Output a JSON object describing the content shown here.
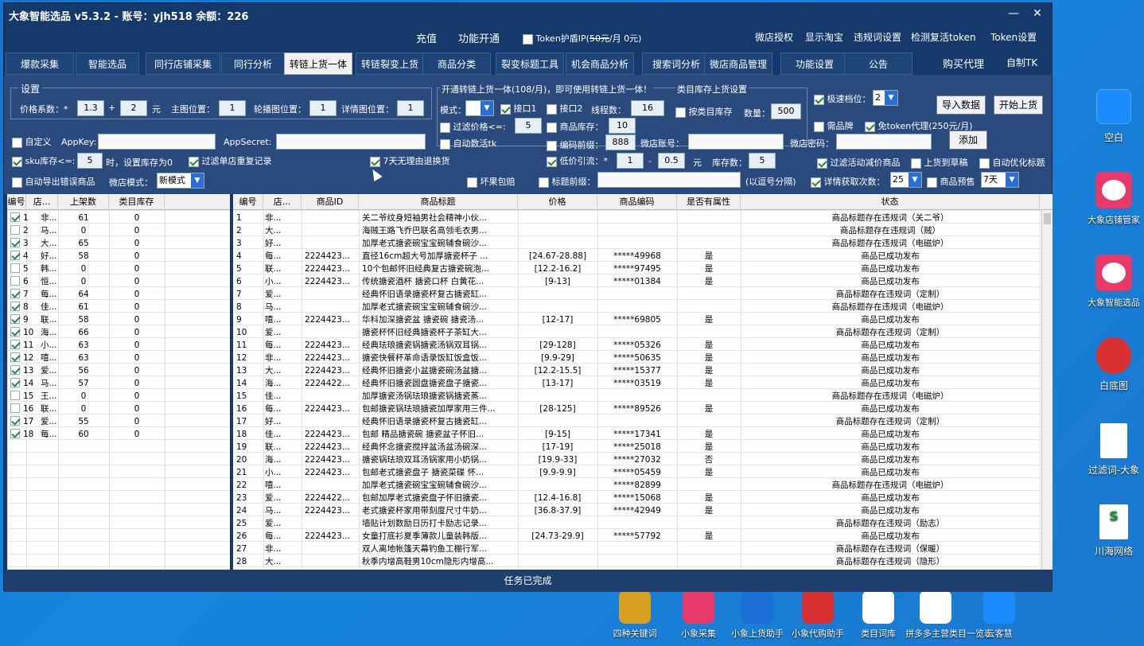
{
  "window": {
    "title": "大象智能选品 v5.3.2 - 账号：yjh518 余额：226",
    "minimize": "—",
    "close": "✕"
  },
  "topmenu": {
    "recharge": "充值",
    "func_open": "功能开通",
    "token_label": "Token护盾IP(",
    "token_price_strike": "50元",
    "token_price_rest": "/月  0元)",
    "store_auth": "微店授权",
    "show_taobao": "显示淘宝",
    "violation_set": "违规词设置",
    "detect_token": "检测复活token",
    "token_set": "Token设置"
  },
  "tabs": [
    "爆款采集",
    "智能选品",
    "同行店铺采集",
    "同行分析",
    "转链上货一体",
    "转链裂变上货",
    "商品分类",
    "裂变标题工具",
    "机会商品分析",
    "搜索词分析",
    "微店商品管理",
    "功能设置",
    "公告"
  ],
  "active_tab": 4,
  "tab_right": {
    "buy_agent": "购买代理",
    "custom_tk": "自制TK"
  },
  "settings": {
    "legend": "设置",
    "price_coef": "价格系数：*",
    "price_coef_val": "1.3",
    "plus": "+",
    "add_val": "2",
    "yuan": "元",
    "main_img": "主图位置：",
    "main_img_val": "1",
    "carousel": "轮播图位置：",
    "carousel_val": "1",
    "detail": "详情图位置：",
    "detail_val": "1",
    "custom": "自定义",
    "appkey": "AppKey:",
    "appsecret": "AppSecret:",
    "sku": "sku库存<=:",
    "sku_val": "5",
    "sku_suffix": "时，设置库存为0",
    "filter_dup": "过滤单店重复记录",
    "seven_day": "7天无理由退换货",
    "auto_export": "自动导出错误商品",
    "store_mode": "微店模式：",
    "store_mode_val": "新模式",
    "bad_fruit": "坏果包赔",
    "title_prefix": "标题前缀：",
    "comma_split": "(以逗号分隔)"
  },
  "open": {
    "legend": "开通转链上货一体(108/月)，即可使用转链上货一体！",
    "mode": "模式：",
    "iface1": "接口1",
    "iface2": "接口2",
    "threads": "线程数：",
    "threads_val": "16",
    "filter_price": "过滤价格<=:",
    "filter_price_val": "5",
    "stock": "商品库存：",
    "stock_val": "10",
    "auto_tk": "自动数活tk",
    "code_prefix": "编码前缀：",
    "code_prefix_val": "888",
    "store_acc": "微店账号：",
    "store_pwd": "微店密码：",
    "add_btn": "添加",
    "low_price": "低价引流：*",
    "low_a": "1",
    "dash": "-",
    "low_b": "0.5",
    "yuan": "元",
    "stock_num": "库存数：",
    "stock_num_val": "5"
  },
  "cat": {
    "legend": "类目库存上货设置",
    "by_cat": "按类目库存",
    "qty": "数量：",
    "qty_val": "500"
  },
  "right": {
    "speed": "极速档位：",
    "speed_val": "2",
    "need_brand": "需品牌",
    "free_token": "免token代理(250元/月)",
    "import": "导入数据",
    "start": "开始上货",
    "filter_promo": "过滤活动减价商品",
    "to_draft": "上货到草稿",
    "auto_opt": "自动优化标题",
    "detail_times": "详情获取次数：",
    "detail_times_val": "25",
    "presale": "商品预售",
    "presale_val": "7天"
  },
  "left_grid": {
    "headers": [
      "编号",
      "店...",
      "上架数",
      "类目库存"
    ],
    "rows": [
      {
        "id": "1",
        "shop": "非...",
        "count": "61",
        "cat": "0",
        "on": true
      },
      {
        "id": "2",
        "shop": "马...",
        "count": "0",
        "cat": "0",
        "on": false
      },
      {
        "id": "3",
        "shop": "大...",
        "count": "65",
        "cat": "0",
        "on": true
      },
      {
        "id": "4",
        "shop": "好...",
        "count": "58",
        "cat": "0",
        "on": true
      },
      {
        "id": "5",
        "shop": "韩...",
        "count": "0",
        "cat": "0",
        "on": false
      },
      {
        "id": "6",
        "shop": "恒...",
        "count": "0",
        "cat": "0",
        "on": false
      },
      {
        "id": "7",
        "shop": "每...",
        "count": "64",
        "cat": "0",
        "on": true
      },
      {
        "id": "8",
        "shop": "佳...",
        "count": "61",
        "cat": "0",
        "on": true
      },
      {
        "id": "9",
        "shop": "联...",
        "count": "58",
        "cat": "0",
        "on": true
      },
      {
        "id": "10",
        "shop": "海...",
        "count": "66",
        "cat": "0",
        "on": true
      },
      {
        "id": "11",
        "shop": "小...",
        "count": "63",
        "cat": "0",
        "on": true
      },
      {
        "id": "12",
        "shop": "嘻...",
        "count": "63",
        "cat": "0",
        "on": true
      },
      {
        "id": "13",
        "shop": "爱...",
        "count": "56",
        "cat": "0",
        "on": true
      },
      {
        "id": "14",
        "shop": "马...",
        "count": "57",
        "cat": "0",
        "on": true
      },
      {
        "id": "15",
        "shop": "王...",
        "count": "0",
        "cat": "0",
        "on": false
      },
      {
        "id": "16",
        "shop": "联...",
        "count": "0",
        "cat": "0",
        "on": false
      },
      {
        "id": "17",
        "shop": "爱...",
        "count": "55",
        "cat": "0",
        "on": true
      },
      {
        "id": "18",
        "shop": "每...",
        "count": "60",
        "cat": "0",
        "on": true
      }
    ]
  },
  "main_grid": {
    "headers": [
      "编号",
      "店...",
      "商品ID",
      "商品标题",
      "价格",
      "商品编码",
      "是否有属性",
      "状态"
    ],
    "rows": [
      [
        "1",
        "非...",
        "",
        "关二爷纹身短袖男社会精神小伙...",
        "",
        "",
        "",
        "商品标题存在违规词（关二爷）"
      ],
      [
        "2",
        "大...",
        "",
        "海贼王路飞乔巴联名高领毛衣男...",
        "",
        "",
        "",
        "商品标题存在违规词（贼）"
      ],
      [
        "3",
        "好...",
        "",
        "加厚老式搪瓷碗宝宝碗辅食碗沙...",
        "",
        "",
        "",
        "商品标题存在违规词（电磁炉）"
      ],
      [
        "4",
        "每...",
        "2224423...",
        "直径16cm超大号加厚搪瓷杯子 ...",
        "[24.67-28.88]",
        "*****49968",
        "是",
        "商品已成功发布"
      ],
      [
        "5",
        "联...",
        "2224423...",
        "10个包邮怀旧经典复古搪瓷碗泡...",
        "[12.2-16.2]",
        "*****97495",
        "是",
        "商品已成功发布"
      ],
      [
        "6",
        "小...",
        "2224423...",
        "传统搪瓷酒杯 搪瓷口杯 白黄花...",
        "[9-13]",
        "*****01384",
        "是",
        "商品已成功发布"
      ],
      [
        "7",
        "爱...",
        "",
        "经典怀旧语录搪瓷杯复古搪瓷缸...",
        "",
        "",
        "",
        "商品标题存在违规词（定制）"
      ],
      [
        "8",
        "马...",
        "",
        "加厚老式搪瓷碗宝宝碗辅食碗沙...",
        "",
        "",
        "",
        "商品标题存在违规词（电磁炉）"
      ],
      [
        "9",
        "嘻...",
        "2224423...",
        "华科加深搪瓷盆 搪瓷碗 搪瓷汤...",
        "[12-17]",
        "*****69805",
        "是",
        "商品已成功发布"
      ],
      [
        "10",
        "爱...",
        "",
        "搪瓷杯怀旧经典搪瓷杯子茶缸大...",
        "",
        "",
        "",
        "商品标题存在违规词（定制）"
      ],
      [
        "11",
        "每...",
        "2224423...",
        "经典珐琅搪瓷锅搪瓷汤锅双耳锅...",
        "[29-128]",
        "*****05326",
        "是",
        "商品已成功发布"
      ],
      [
        "12",
        "非...",
        "2224423...",
        "搪瓷快餐杯革命语录饭缸饭盒饭...",
        "[9.9-29]",
        "*****50635",
        "是",
        "商品已成功发布"
      ],
      [
        "13",
        "大...",
        "2224423...",
        "经典怀旧搪瓷小盆搪瓷碗汤盆搪...",
        "[12.2-15.5]",
        "*****15377",
        "是",
        "商品已成功发布"
      ],
      [
        "14",
        "海...",
        "2224422...",
        "经典怀旧搪瓷圆盘搪瓷盘子搪瓷...",
        "[13-17]",
        "*****03519",
        "是",
        "商品已成功发布"
      ],
      [
        "15",
        "佳...",
        "",
        "加厚搪瓷汤锅珐琅搪瓷锅搪瓷蒸...",
        "",
        "",
        "",
        "商品标题存在违规词（电磁炉）"
      ],
      [
        "16",
        "每...",
        "2224423...",
        "包邮搪瓷锅珐琅搪瓷加厚家用三件...",
        "[28-125]",
        "*****89526",
        "是",
        "商品已成功发布"
      ],
      [
        "17",
        "好...",
        "",
        "经典怀旧语录搪瓷杯复古搪瓷缸...",
        "",
        "",
        "",
        "商品标题存在违规词（定制）"
      ],
      [
        "18",
        "佳...",
        "2224423...",
        "包邮 精品搪瓷碗 搪瓷盆子怀旧...",
        "[9-15]",
        "*****17341",
        "是",
        "商品已成功发布"
      ],
      [
        "19",
        "联...",
        "2224423...",
        "经典怀念搪瓷搅拌盆汤盆汤碗深...",
        "[17-19]",
        "*****25018",
        "是",
        "商品已成功发布"
      ],
      [
        "20",
        "海...",
        "2224423...",
        "搪瓷锅珐琅双耳汤锅家用小奶锅...",
        "[19.9-33]",
        "*****27032",
        "否",
        "商品已成功发布"
      ],
      [
        "21",
        "小...",
        "2224423...",
        "包邮老式搪瓷盘子 搪瓷菜碟 怀...",
        "[9.9-9.9]",
        "*****05459",
        "是",
        "商品已成功发布"
      ],
      [
        "22",
        "嘻...",
        "",
        "加厚老式搪瓷碗宝宝碗辅食碗沙...",
        "",
        "*****82899",
        "",
        "商品标题存在违规词（电磁炉）"
      ],
      [
        "23",
        "爱...",
        "2224422...",
        "包邮加厚老式搪瓷盘子怀旧搪瓷...",
        "[12.4-16.8]",
        "*****15068",
        "是",
        "商品已成功发布"
      ],
      [
        "24",
        "马...",
        "2224423...",
        "老式搪瓷杯家用带刻度尺寸牛奶...",
        "[36.8-37.9]",
        "*****42949",
        "是",
        "商品已成功发布"
      ],
      [
        "25",
        "爱...",
        "",
        "墙贴计划数励日历打卡励志记录...",
        "",
        "",
        "",
        "商品标题存在违规词（励志）"
      ],
      [
        "26",
        "每...",
        "2224423...",
        "女童打底衫夏季薄款儿童装韩版...",
        "[24.73-29.9]",
        "*****57792",
        "是",
        "商品已成功发布"
      ],
      [
        "27",
        "非...",
        "",
        "双人离地帐篷天幕钓鱼工棚行军...",
        "",
        "",
        "",
        "商品标题存在违规词（保暖）"
      ],
      [
        "28",
        "大...",
        "",
        "秋季内增高鞋男10cm隐形内增高...",
        "",
        "",
        "",
        "商品标题存在违规词（隐形）"
      ]
    ]
  },
  "status": "任务已完成",
  "desktop_right": [
    {
      "label": "空白",
      "icon": "blank-icon"
    },
    {
      "label": "大象店铺管家",
      "icon": "elephant-icon"
    },
    {
      "label": "大象智能选品",
      "icon": "elephant-icon"
    },
    {
      "label": "白底图",
      "icon": "mascot-icon"
    },
    {
      "label": "过滤词-大象",
      "icon": "document-icon"
    },
    {
      "label": "川海网络",
      "icon": "spreadsheet-icon"
    }
  ],
  "taskbar_icons": [
    {
      "label": "四种关键词",
      "icon": "books-icon"
    },
    {
      "label": "小象采集",
      "icon": "elephant-icon"
    },
    {
      "label": "小象上货助手",
      "icon": "grid-icon"
    },
    {
      "label": "小象代购助手",
      "icon": "shopping-icon"
    },
    {
      "label": "类目词库",
      "icon": "spreadsheet-icon"
    },
    {
      "label": "拼多多主营类目一览表",
      "icon": "spreadsheet-icon"
    },
    {
      "label": "云客慧",
      "icon": "cloud-icon"
    }
  ]
}
